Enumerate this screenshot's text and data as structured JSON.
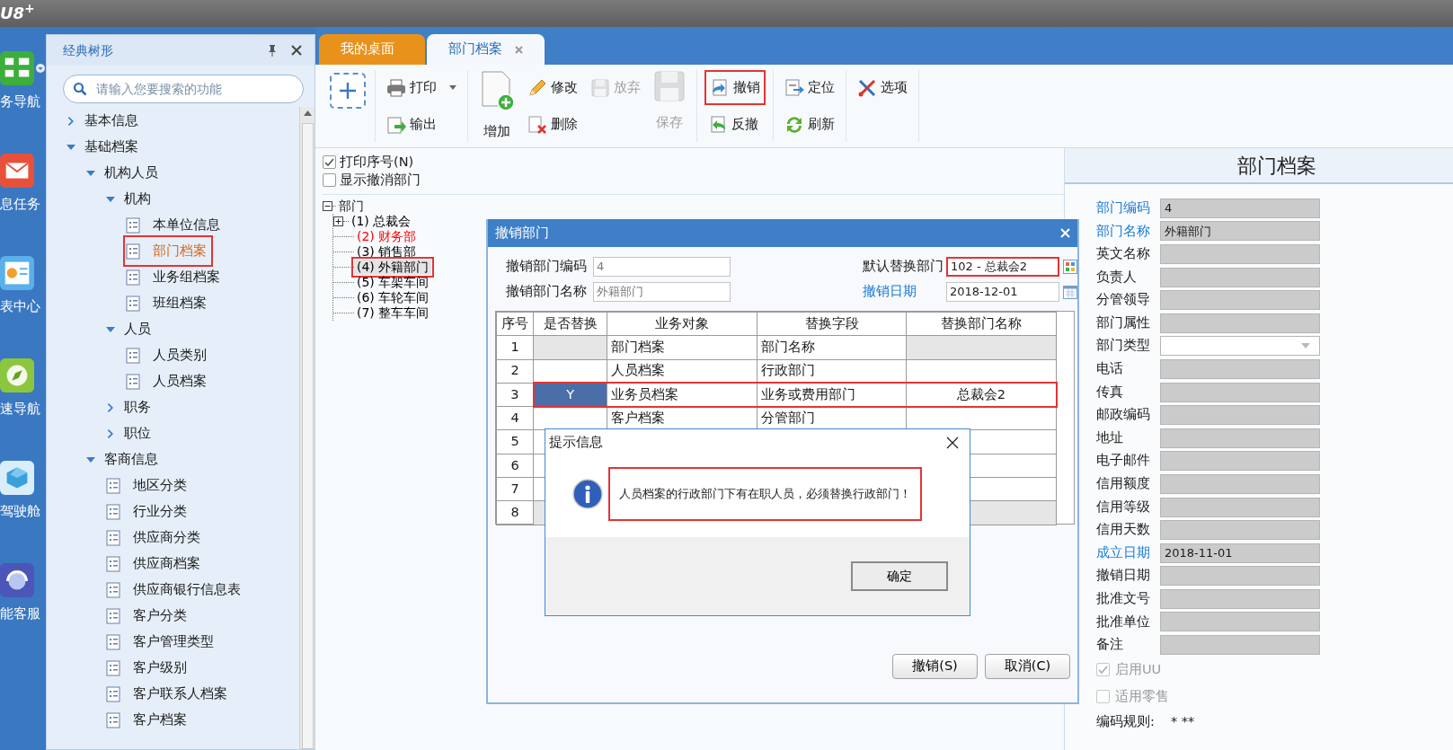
{
  "app": {
    "logo": "U8$^{+}$"
  },
  "rail": [
    {
      "label": "务导航",
      "dropdown": true
    },
    {
      "label": "息任务",
      "dropdown": false
    },
    {
      "label": "表中心",
      "dropdown": false
    },
    {
      "label": "速导航",
      "dropdown": false
    },
    {
      "label": "驾驶舱",
      "dropdown": false
    },
    {
      "label": "能客服",
      "dropdown": false
    }
  ],
  "nav_panel": {
    "title": "经典树形",
    "search": {
      "placeholder": "请输入您要搜索的功能"
    },
    "tree": [
      {
        "label": "基本信息",
        "kind": "folder",
        "expanded": false
      },
      {
        "label": "基础档案",
        "kind": "folder",
        "expanded": true,
        "children": [
          {
            "label": "机构人员",
            "kind": "folder",
            "expanded": true,
            "children": [
              {
                "label": "机构",
                "kind": "folder",
                "expanded": true,
                "children": [
                  {
                    "label": "本单位信息",
                    "kind": "leaf",
                    "selected": false
                  },
                  {
                    "label": "部门档案",
                    "kind": "leaf",
                    "selected": true
                  },
                  {
                    "label": "业务组档案",
                    "kind": "leaf",
                    "selected": false
                  },
                  {
                    "label": "班组档案",
                    "kind": "leaf",
                    "selected": false
                  }
                ]
              },
              {
                "label": "人员",
                "kind": "folder",
                "expanded": true,
                "children": [
                  {
                    "label": "人员类别",
                    "kind": "leaf",
                    "selected": false
                  },
                  {
                    "label": "人员档案",
                    "kind": "leaf",
                    "selected": false
                  }
                ]
              },
              {
                "label": "职务",
                "kind": "folder",
                "expanded": false
              },
              {
                "label": "职位",
                "kind": "folder",
                "expanded": false
              }
            ]
          },
          {
            "label": "客商信息",
            "kind": "folder",
            "expanded": true,
            "children": [
              {
                "label": "地区分类",
                "kind": "leaf",
                "selected": false
              },
              {
                "label": "行业分类",
                "kind": "leaf",
                "selected": false
              },
              {
                "label": "供应商分类",
                "kind": "leaf",
                "selected": false
              },
              {
                "label": "供应商档案",
                "kind": "leaf",
                "selected": false
              },
              {
                "label": "供应商银行信息表",
                "kind": "leaf",
                "selected": false
              },
              {
                "label": "客户分类",
                "kind": "leaf",
                "selected": false
              },
              {
                "label": "客户管理类型",
                "kind": "leaf",
                "selected": false
              },
              {
                "label": "客户级别",
                "kind": "leaf",
                "selected": false
              },
              {
                "label": "客户联系人档案",
                "kind": "leaf",
                "selected": false
              },
              {
                "label": "客户档案",
                "kind": "leaf",
                "selected": false
              }
            ]
          }
        ]
      }
    ]
  },
  "tabs": [
    {
      "label": "我的桌面",
      "selected": false,
      "closable": false
    },
    {
      "label": "部门档案",
      "selected": true,
      "closable": true
    }
  ],
  "toolbar": [
    [
      [
        {
          "kind": "tile"
        }
      ]
    ],
    [
      [
        {
          "label": "打印",
          "kind": "small",
          "dropdown": true,
          "disabled": false,
          "highlighted": false
        },
        {
          "label": "输出",
          "kind": "small",
          "disabled": false,
          "highlighted": false
        }
      ]
    ],
    [
      [
        {
          "label": "增加",
          "kind": "large",
          "disabled": false,
          "highlighted": false
        }
      ],
      [
        {
          "label": "修改",
          "kind": "small",
          "disabled": false,
          "highlighted": false
        },
        {
          "label": "删除",
          "kind": "small",
          "disabled": false,
          "highlighted": false
        }
      ],
      [
        {
          "label": "放弃",
          "kind": "small",
          "disabled": true,
          "highlighted": false
        }
      ],
      [
        {
          "label": "保存",
          "kind": "large",
          "disabled": true,
          "highlighted": false
        }
      ]
    ],
    [
      [
        {
          "label": "撤销",
          "kind": "small",
          "disabled": false,
          "highlighted": true
        },
        {
          "label": "反撤",
          "kind": "small",
          "disabled": false,
          "highlighted": false
        }
      ]
    ],
    [
      [
        {
          "label": "定位",
          "kind": "small",
          "disabled": false,
          "highlighted": false
        },
        {
          "label": "刷新",
          "kind": "small",
          "disabled": false,
          "highlighted": false
        }
      ]
    ],
    [
      [
        {
          "label": "选项",
          "kind": "small",
          "disabled": false,
          "highlighted": false
        }
      ]
    ]
  ],
  "options": [
    {
      "label": "打印序号(N)",
      "checked": true
    },
    {
      "label": "显示撤消部门",
      "checked": false
    }
  ],
  "dept_tree": {
    "label": "部门",
    "expanded": true,
    "children": [
      {
        "label": "(1) 总裁会",
        "kind": "branch",
        "expanded": false,
        "selected": false,
        "color": "#000000"
      },
      {
        "label": "(2) 财务部",
        "kind": "leaf",
        "selected": false,
        "color": "#ff0000"
      },
      {
        "label": "(3) 销售部",
        "kind": "leaf",
        "selected": false,
        "color": "#000000"
      },
      {
        "label": "(4) 外籍部门",
        "kind": "leaf",
        "selected": true,
        "color": "#000000"
      },
      {
        "label": "(5) 车架车间",
        "kind": "leaf",
        "selected": false,
        "color": "#000000"
      },
      {
        "label": "(6) 车轮车间",
        "kind": "leaf",
        "selected": false,
        "color": "#000000"
      },
      {
        "label": "(7) 整车车间",
        "kind": "leaf",
        "selected": false,
        "color": "#000000"
      }
    ]
  },
  "detail": {
    "title": "部门档案",
    "fields": [
      {
        "label": "部门编码",
        "value": "4",
        "required": true,
        "kind": "text"
      },
      {
        "label": "部门名称",
        "value": "外籍部门",
        "required": true,
        "kind": "text"
      },
      {
        "label": "英文名称",
        "required": false,
        "kind": "text"
      },
      {
        "label": "负责人",
        "required": false,
        "kind": "text"
      },
      {
        "label": "分管领导",
        "required": false,
        "kind": "text"
      },
      {
        "label": "部门属性",
        "required": false,
        "kind": "text"
      },
      {
        "label": "部门类型",
        "required": false,
        "kind": "select"
      },
      {
        "label": "电话",
        "required": false,
        "kind": "text"
      },
      {
        "label": "传真",
        "required": false,
        "kind": "text"
      },
      {
        "label": "邮政编码",
        "required": false,
        "kind": "text"
      },
      {
        "label": "地址",
        "required": false,
        "kind": "text"
      },
      {
        "label": "电子邮件",
        "required": false,
        "kind": "text"
      },
      {
        "label": "信用额度",
        "required": false,
        "kind": "text"
      },
      {
        "label": "信用等级",
        "required": false,
        "kind": "text"
      },
      {
        "label": "信用天数",
        "required": false,
        "kind": "text"
      },
      {
        "label": "成立日期",
        "value": "2018-11-01",
        "required": true,
        "kind": "text"
      },
      {
        "label": "撤销日期",
        "required": false,
        "kind": "text"
      },
      {
        "label": "批准文号",
        "required": false,
        "kind": "text"
      },
      {
        "label": "批准单位",
        "required": false,
        "kind": "text"
      },
      {
        "label": "备注",
        "required": false,
        "kind": "text"
      }
    ],
    "checkboxes": [
      {
        "label": "启用UU",
        "checked": true,
        "disabled": true
      },
      {
        "label": "适用零售",
        "checked": false,
        "disabled": true
      }
    ],
    "code_rule": {
      "label": "编码规则:",
      "value": "* **"
    }
  },
  "revoke_dialog": {
    "title": "撤销部门",
    "fields": [
      {
        "label": "撤销部门编码",
        "value": "4",
        "kind": "text",
        "required": false,
        "highlighted": false
      },
      {
        "label": "默认替换部门",
        "value": "102 - 总裁会2",
        "kind": "reference",
        "required": false,
        "highlighted": true
      },
      {
        "label": "撤销部门名称",
        "value": "外籍部门",
        "kind": "text",
        "required": false,
        "highlighted": false
      },
      {
        "label": "撤销日期",
        "value": "2018-12-01",
        "kind": "date",
        "required": true,
        "highlighted": false
      }
    ],
    "columns": [
      "序号",
      "是否替换",
      "业务对象",
      "替换字段",
      "替换部门名称"
    ],
    "rows": [
      {
        "index": "1",
        "object": "部门档案",
        "field": "部门名称",
        "locked": true,
        "selected": false,
        "highlighted": false
      },
      {
        "index": "2",
        "object": "人员档案",
        "field": "行政部门",
        "locked": false,
        "selected": false,
        "highlighted": false
      },
      {
        "index": "3",
        "replace": "Y",
        "object": "业务员档案",
        "field": "业务或费用部门",
        "dept": "总裁会2",
        "locked": false,
        "selected": true,
        "highlighted": true
      },
      {
        "index": "4",
        "object": "客户档案",
        "field": "分管部门",
        "locked": false,
        "selected": false,
        "highlighted": false
      },
      {
        "index": "5",
        "locked": false,
        "selected": false,
        "highlighted": false
      },
      {
        "index": "6",
        "locked": false,
        "selected": false,
        "highlighted": false
      },
      {
        "index": "7",
        "locked": false,
        "selected": false,
        "highlighted": false
      },
      {
        "index": "8",
        "locked": true,
        "selected": false,
        "highlighted": false
      }
    ],
    "buttons": [
      "撤销(S)",
      "取消(C)"
    ]
  },
  "message_box": {
    "title": "提示信息",
    "message": "人员档案的行政部门下有在职人员，必须替换行政部门！",
    "highlighted": true,
    "buttons": [
      "确定"
    ]
  }
}
